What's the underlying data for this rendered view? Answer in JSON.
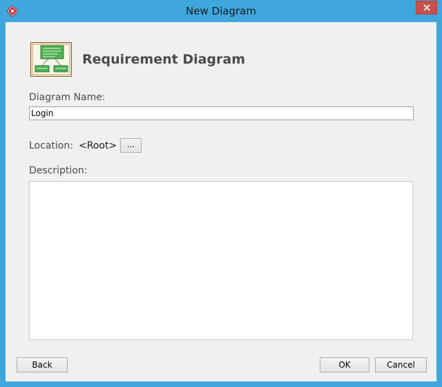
{
  "window": {
    "title": "New Diagram"
  },
  "header": {
    "diagram_type": "Requirement Diagram",
    "icon": "requirement-diagram-icon"
  },
  "form": {
    "name_label": "Diagram Name:",
    "name_value": "Login",
    "location_label": "Location:",
    "location_value": "<Root>",
    "browse_label": "...",
    "description_label": "Description:",
    "description_value": ""
  },
  "buttons": {
    "back": "Back",
    "ok": "OK",
    "cancel": "Cancel"
  },
  "colors": {
    "titlebar": "#3fa7dd",
    "close": "#c7504b",
    "accent_green": "#4caf50"
  }
}
